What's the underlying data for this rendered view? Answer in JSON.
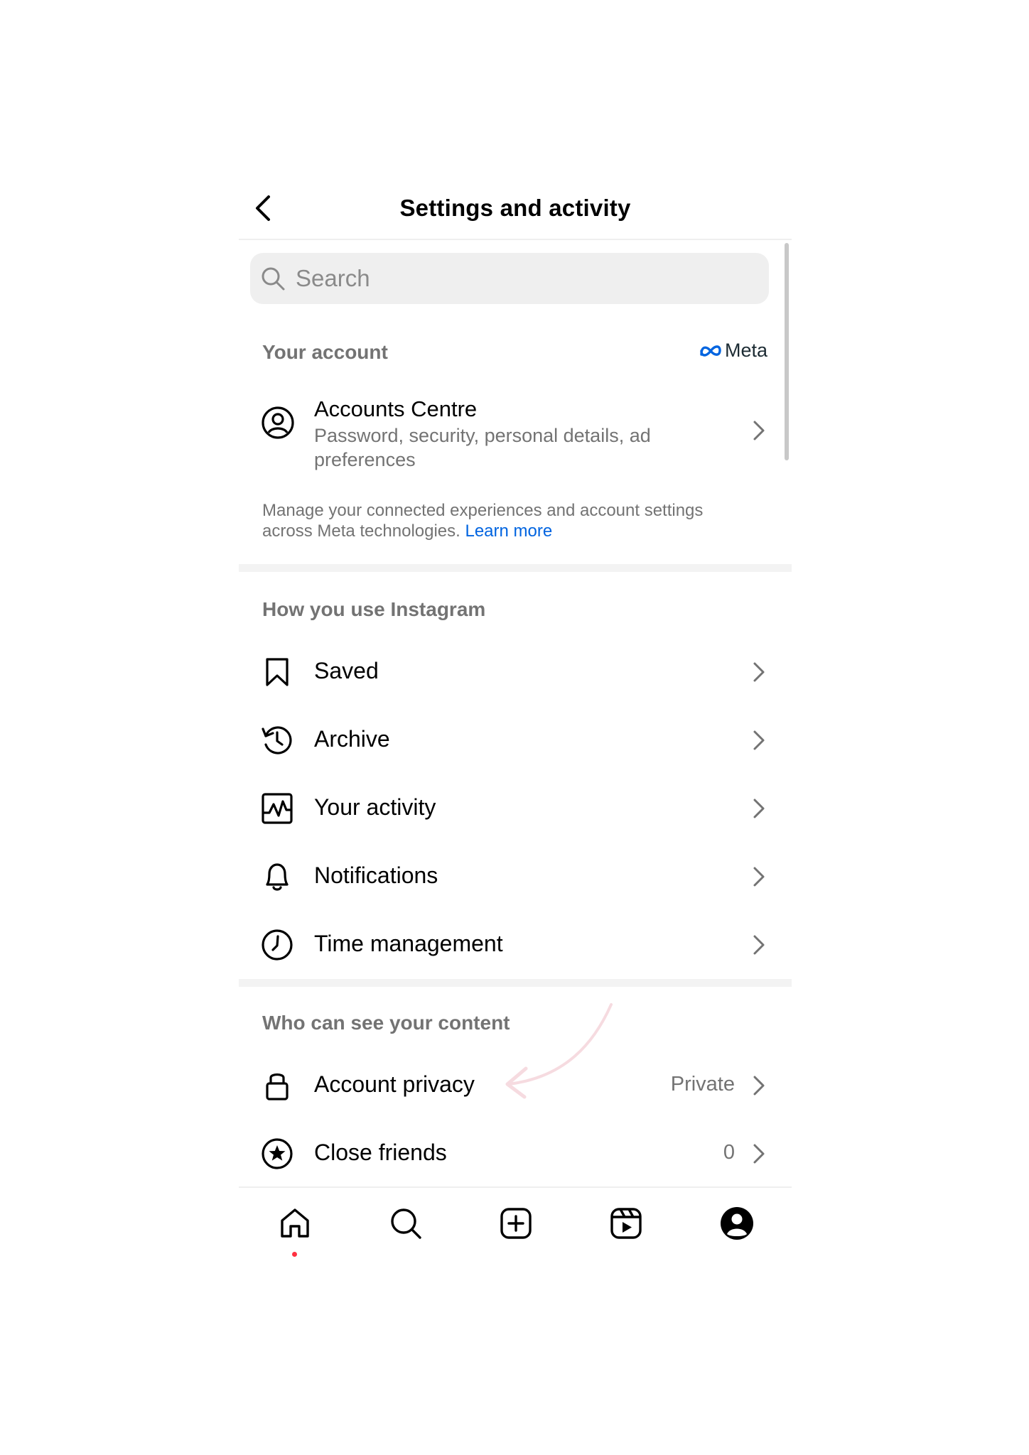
{
  "header": {
    "title": "Settings and activity"
  },
  "search": {
    "placeholder": "Search"
  },
  "your_account": {
    "title": "Your account",
    "brand": "Meta",
    "accounts_centre": {
      "title": "Accounts Centre",
      "subtitle": "Password, security, personal details, ad preferences"
    },
    "note": "Manage your connected experiences and account settings across Meta technologies.",
    "learn_more": "Learn more"
  },
  "how_you_use": {
    "title": "How you use Instagram",
    "items": [
      {
        "label": "Saved",
        "icon": "bookmark-icon"
      },
      {
        "label": "Archive",
        "icon": "archive-icon"
      },
      {
        "label": "Your activity",
        "icon": "activity-icon"
      },
      {
        "label": "Notifications",
        "icon": "bell-icon"
      },
      {
        "label": "Time management",
        "icon": "clock-icon"
      }
    ]
  },
  "who_can_see": {
    "title": "Who can see your content",
    "items": [
      {
        "label": "Account privacy",
        "value": "Private",
        "icon": "lock-icon"
      },
      {
        "label": "Close friends",
        "value": "0",
        "icon": "star-icon"
      }
    ]
  },
  "tabbar": {
    "items": [
      "home-icon",
      "search-icon",
      "create-icon",
      "reels-icon",
      "profile-icon"
    ],
    "active": "home-icon"
  },
  "colors": {
    "accent_link": "#0064e0",
    "notification_dot": "#ff3040",
    "secondary_text": "#737373",
    "annotation_arrow": "#f6dbe0"
  }
}
